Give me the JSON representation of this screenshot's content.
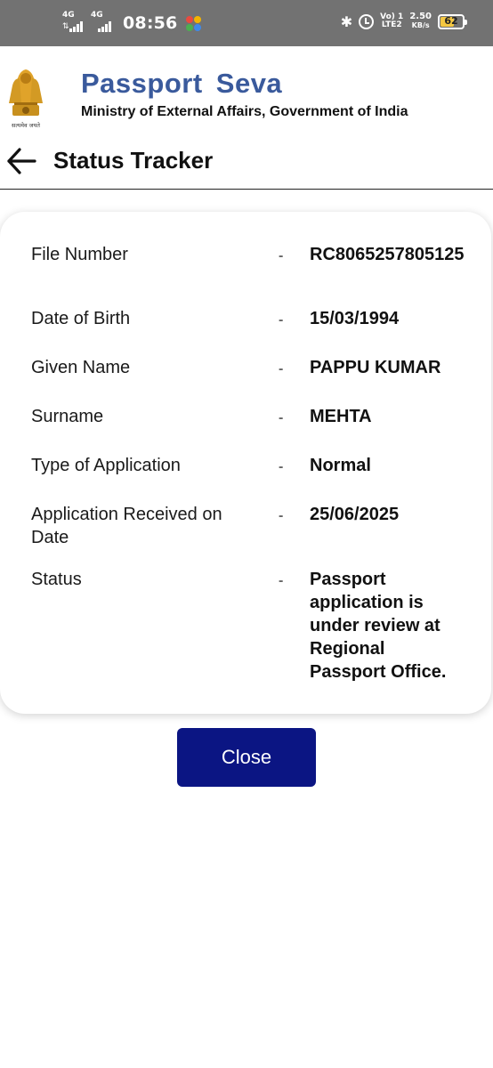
{
  "status_bar": {
    "net1": "4G",
    "net2": "4G",
    "time": "08:56",
    "volte_top": "Vo) 1",
    "volte_bottom": "LTE2",
    "speed_value": "2.50",
    "speed_unit": "KB/s",
    "battery": "62",
    "battery_fraction": 0.62
  },
  "header": {
    "app_title": "Passport  Seva",
    "app_subtitle": "Ministry of External Affairs, Government of India",
    "emblem_motto": "सत्यमेव जयते"
  },
  "toolbar": {
    "page_title": "Status Tracker"
  },
  "details": {
    "rows": [
      {
        "label": "File Number",
        "value": "RC8065257805125"
      },
      {
        "label": "Date of Birth",
        "value": "15/03/1994"
      },
      {
        "label": "Given Name",
        "value": "PAPPU KUMAR"
      },
      {
        "label": "Surname",
        "value": "MEHTA"
      },
      {
        "label": "Type of Application",
        "value": "Normal"
      },
      {
        "label": "Application Received on Date",
        "value": "25/06/2025"
      },
      {
        "label": "Status",
        "value": "Passport application is under review at Regional Passport Office."
      }
    ],
    "separator": "-"
  },
  "actions": {
    "close_label": "Close"
  },
  "colors": {
    "title_blue": "#3a5a9c",
    "button_navy": "#0b1583",
    "status_bar": "#727272"
  }
}
